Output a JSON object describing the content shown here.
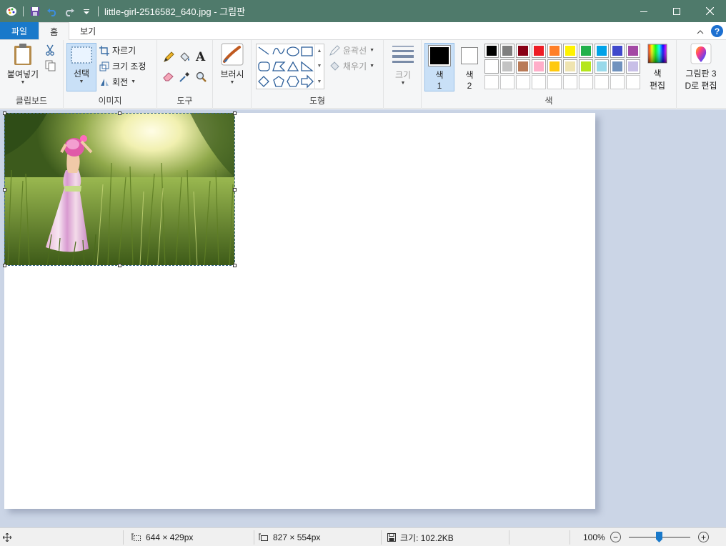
{
  "window": {
    "title": "little-girl-2516582_640.jpg - 그림판"
  },
  "tabs": {
    "file": "파일",
    "home": "홈",
    "view": "보기"
  },
  "ribbon": {
    "clipboard": {
      "paste": "붙여넣기",
      "label": "클립보드"
    },
    "image": {
      "select": "선택",
      "crop": "자르기",
      "resize": "크기 조정",
      "rotate": "회전",
      "label": "이미지"
    },
    "tools": {
      "label": "도구"
    },
    "brushes": {
      "label": "브러시"
    },
    "shapes": {
      "outline": "윤곽선",
      "fill": "채우기",
      "label": "도형"
    },
    "size": {
      "label": "크기"
    },
    "colors": {
      "color1": "색",
      "color1_num": "1",
      "color2": "색",
      "color2_num": "2",
      "edit_colors_1": "색",
      "edit_colors_2": "편집",
      "paint3d_1": "그림판 3",
      "paint3d_2": "D로 편집",
      "label": "색",
      "primary": "#000000",
      "secondary": "#ffffff",
      "palette_row1": [
        "#000000",
        "#7f7f7f",
        "#880015",
        "#ed1c24",
        "#ff7f27",
        "#fff200",
        "#22b14c",
        "#00a2e8",
        "#3f48cc",
        "#a349a4"
      ],
      "palette_row2": [
        "#ffffff",
        "#c3c3c3",
        "#b97a57",
        "#ffaec9",
        "#ffc90e",
        "#efe4b0",
        "#b5e61d",
        "#99d9ea",
        "#7092be",
        "#c8bfe7"
      ],
      "palette_row3": [
        "#ffffff",
        "#ffffff",
        "#ffffff",
        "#ffffff",
        "#ffffff",
        "#ffffff",
        "#ffffff",
        "#ffffff",
        "#ffffff",
        "#ffffff"
      ]
    }
  },
  "status": {
    "selection_size": "644 × 429px",
    "canvas_size": "827 × 554px",
    "file_size": "크기: 102.2KB",
    "zoom": "100%"
  }
}
